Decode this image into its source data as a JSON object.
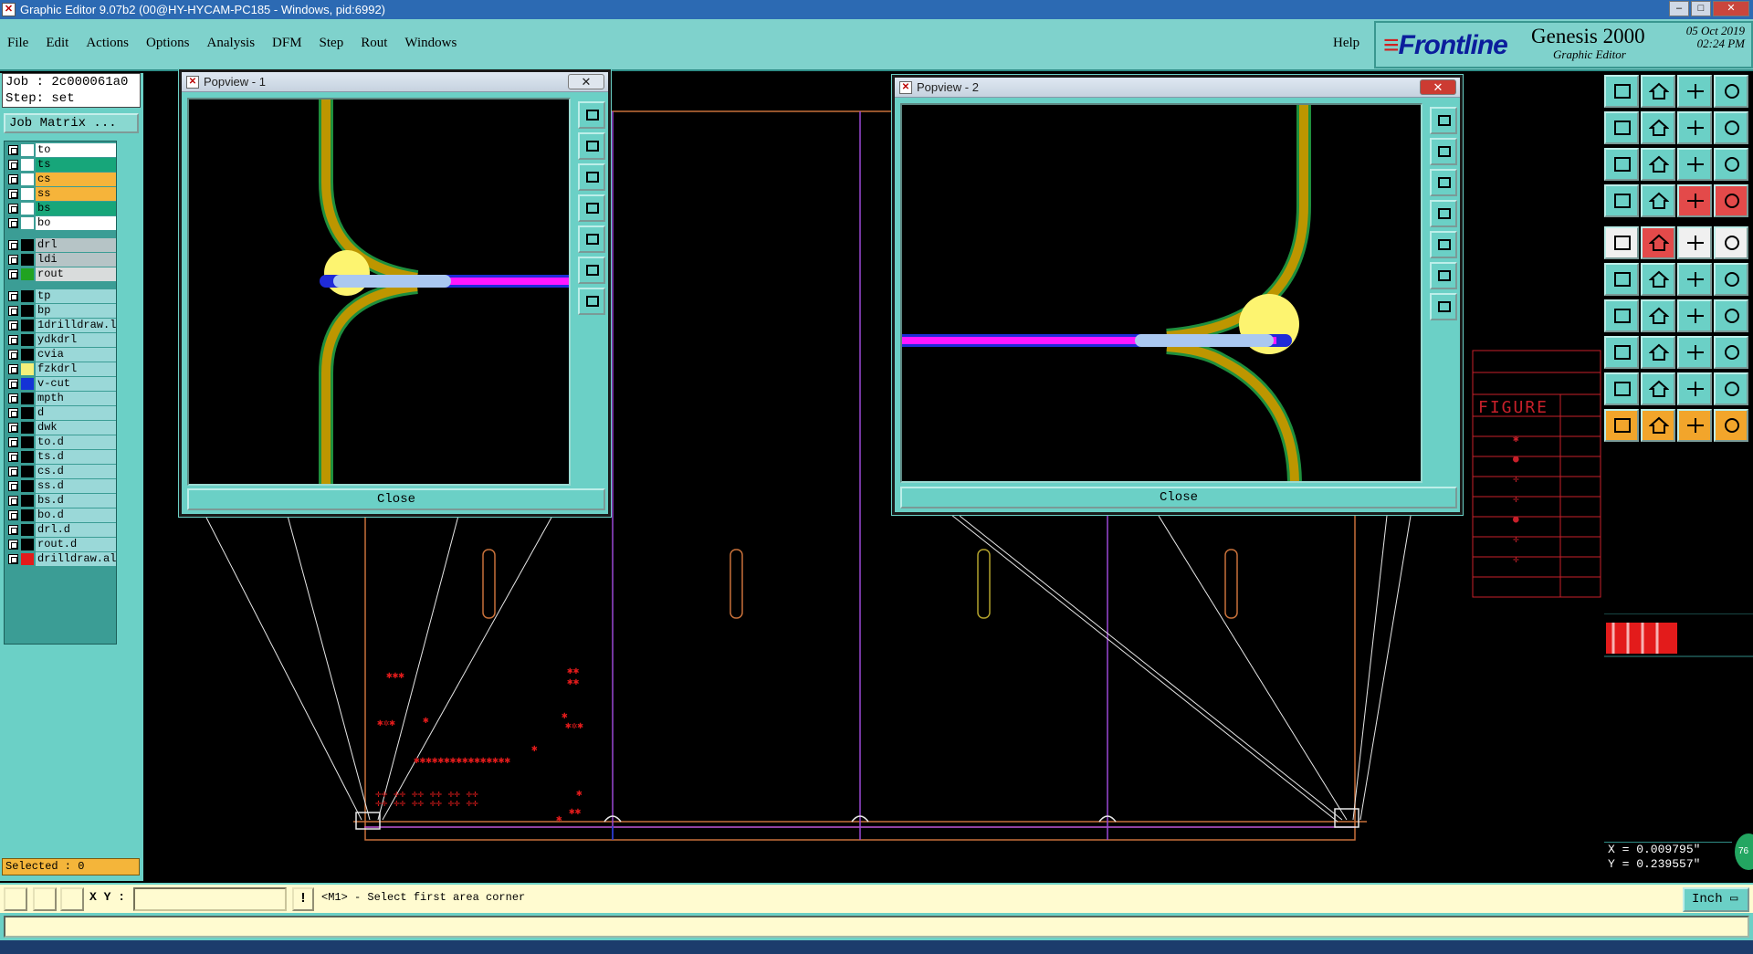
{
  "window": {
    "title": "Graphic Editor 9.07b2 (00@HY-HYCAM-PC185 - Windows, pid:6992)",
    "icon": "app-icon"
  },
  "menu": {
    "items": [
      "File",
      "Edit",
      "Actions",
      "Options",
      "Analysis",
      "DFM",
      "Step",
      "Rout",
      "Windows"
    ],
    "help": "Help"
  },
  "brand": {
    "logo": "Frontline",
    "product": "Genesis 2000",
    "subtitle": "Graphic Editor",
    "date": "05 Oct 2019",
    "time": "02:24 PM"
  },
  "job": {
    "job_line": "Job : 2c000061a0",
    "step_line": "Step: set",
    "matrix_button": "Job Matrix ..."
  },
  "layers": [
    {
      "name": "to",
      "color": "#ffffff",
      "text_bg": "#ffffff"
    },
    {
      "name": "ts",
      "color": "#ffffff",
      "text_bg": "#17a67a"
    },
    {
      "name": "cs",
      "color": "#ffffff",
      "text_bg": "#f6b43a"
    },
    {
      "name": "ss",
      "color": "#ffffff",
      "text_bg": "#f6b43a"
    },
    {
      "name": "bs",
      "color": "#ffffff",
      "text_bg": "#17a67a"
    },
    {
      "name": "bo",
      "color": "#ffffff",
      "text_bg": "#ffffff"
    },
    {
      "name": "drl",
      "color": "#000000",
      "text_bg": "#b6c4c6"
    },
    {
      "name": "ldi",
      "color": "#000000",
      "text_bg": "#b6c4c6"
    },
    {
      "name": "rout",
      "color": "#21a321",
      "text_bg": "#d9dcdc"
    },
    {
      "name": "tp",
      "color": "#000000",
      "text_bg": "#9ad8d8"
    },
    {
      "name": "bp",
      "color": "#000000",
      "text_bg": "#9ad8d8"
    },
    {
      "name": "1drilldraw.l",
      "color": "#000000",
      "text_bg": "#9ad8d8"
    },
    {
      "name": "ydkdrl",
      "color": "#000000",
      "text_bg": "#9ad8d8"
    },
    {
      "name": "cvia",
      "color": "#000000",
      "text_bg": "#9ad8d8"
    },
    {
      "name": "fzkdrl",
      "color": "#f5f07a",
      "text_bg": "#9ad8d8"
    },
    {
      "name": "v-cut",
      "color": "#1433d6",
      "text_bg": "#9ad8d8"
    },
    {
      "name": "mpth",
      "color": "#000000",
      "text_bg": "#9ad8d8"
    },
    {
      "name": "d",
      "color": "#000000",
      "text_bg": "#9ad8d8"
    },
    {
      "name": "dwk",
      "color": "#000000",
      "text_bg": "#9ad8d8"
    },
    {
      "name": "to.d",
      "color": "#000000",
      "text_bg": "#9ad8d8"
    },
    {
      "name": "ts.d",
      "color": "#000000",
      "text_bg": "#9ad8d8"
    },
    {
      "name": "cs.d",
      "color": "#000000",
      "text_bg": "#9ad8d8"
    },
    {
      "name": "ss.d",
      "color": "#000000",
      "text_bg": "#9ad8d8"
    },
    {
      "name": "bs.d",
      "color": "#000000",
      "text_bg": "#9ad8d8"
    },
    {
      "name": "bo.d",
      "color": "#000000",
      "text_bg": "#9ad8d8"
    },
    {
      "name": "drl.d",
      "color": "#000000",
      "text_bg": "#9ad8d8"
    },
    {
      "name": "rout.d",
      "color": "#000000",
      "text_bg": "#9ad8d8"
    },
    {
      "name": "drilldraw.al",
      "color": "#e31b1b",
      "text_bg": "#9ad8d8"
    }
  ],
  "selected": "Selected : 0",
  "popups": [
    {
      "title": "Popview - 1",
      "close_label": "Close"
    },
    {
      "title": "Popview - 2",
      "close_label": "Close"
    }
  ],
  "figure_table": {
    "header": "FIGURE"
  },
  "coords": {
    "x": "X = 0.009795\"",
    "y": "Y = 0.239557\""
  },
  "badge": "76",
  "statusbar": {
    "xy_label": "X Y :",
    "xy_value": "",
    "message": "<M1> - Select first area corner",
    "unit": "Inch"
  },
  "toolbar_icons": [
    "home-view-icon",
    "zoom-in-icon",
    "house-icon",
    "split-icon",
    "pan-left-icon",
    "pan-right-icon",
    "mirror-icon",
    "flip-icon",
    "zoom-fit-icon",
    "zoom-area-icon",
    "scale-1-2-icon",
    "help-icon",
    "snap-icon",
    "grid-icon",
    "layer-add-icon",
    "layer-edit-icon",
    "measure-icon",
    "redline-icon",
    "ruler-icon",
    "circle-icon",
    "connect-icon",
    "cross-icon",
    "vertex-icon",
    "line-node-icon",
    "draw-line-icon",
    "slope-icon",
    "rotate-icon",
    "split-line-icon",
    "box-select-icon",
    "minus-icon",
    "move-icon",
    "array-icon",
    "triangle-icon",
    "arrow-a-icon",
    "arc-icon",
    "pin-icon",
    "pointer-icon",
    "pointer-2-icon",
    "pointer-3-icon",
    "pointer-tree-icon"
  ],
  "colors": {
    "accent": "#6bd0c6",
    "status_bg": "#fffbd0",
    "trace_mustard": "#bd9600",
    "trace_green": "#1f8f3d",
    "route_magenta": "#ff18ff",
    "route_blue": "#1f2bd8",
    "drill_yellow": "#fdf470"
  }
}
